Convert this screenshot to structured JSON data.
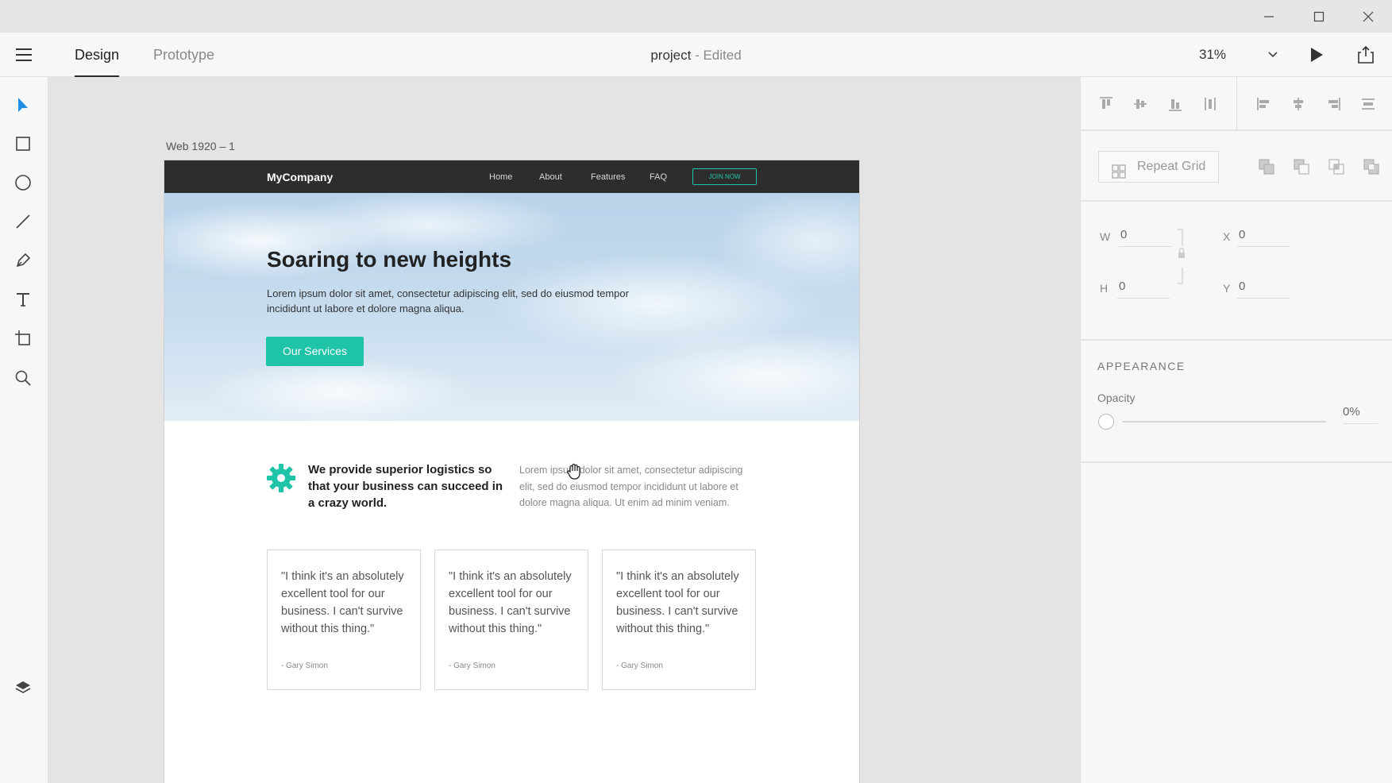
{
  "window": {
    "controls": [
      "minimize-icon",
      "maximize-icon",
      "close-icon"
    ]
  },
  "toolbar": {
    "menu_icon": "hamburger-icon",
    "tabs": [
      {
        "label": "Design",
        "active": true
      },
      {
        "label": "Prototype",
        "active": false
      }
    ],
    "document_name": "project",
    "document_status": " - Edited",
    "zoom": "31%",
    "play_icon": "play-icon",
    "share_icon": "share-icon"
  },
  "tools": [
    "select-icon",
    "rectangle-icon",
    "ellipse-icon",
    "line-icon",
    "pen-icon",
    "text-icon",
    "artboard-icon",
    "zoom-icon",
    "layers-icon"
  ],
  "canvas": {
    "artboard_label": "Web 1920 – 1",
    "site": {
      "brand": "MyCompany",
      "nav": [
        "Home",
        "About",
        "Features",
        "FAQ"
      ],
      "join": "JOIN NOW",
      "accent": "#1fc4a8",
      "hero": {
        "title": "Soaring to new heights",
        "text": "Lorem ipsum dolor sit amet, consectetur adipiscing elit, sed do eiusmod tempor incididunt ut labore et dolore magna aliqua.",
        "cta": "Our Services"
      },
      "feature": {
        "icon": "gear-icon",
        "title": "We provide superior logistics so that your business can succeed in a crazy world.",
        "text": "Lorem ipsum dolor sit amet, consectetur adipiscing elit, sed do eiusmod tempor incididunt ut labore et dolore magna aliqua. Ut enim ad minim veniam."
      },
      "testimonials": [
        {
          "quote": "\"I think it's an absolutely excellent tool for our business. I can't survive without this thing.\"",
          "author": "- Gary Simon"
        },
        {
          "quote": "\"I think it's an absolutely excellent tool for our business. I can't survive without this thing.\"",
          "author": "- Gary Simon"
        },
        {
          "quote": "\"I think it's an absolutely excellent tool for our business. I can't survive without this thing.\"",
          "author": "- Gary Simon"
        }
      ]
    }
  },
  "panel": {
    "align_icons": [
      "align-top-icon",
      "align-middle-icon",
      "align-bottom-icon",
      "distribute-vertical-icon",
      "align-left-icon",
      "align-center-icon",
      "align-right-icon",
      "distribute-horizontal-icon"
    ],
    "repeat_grid": "Repeat Grid",
    "boolean_icons": [
      "add-icon",
      "subtract-icon",
      "intersect-icon",
      "exclude-icon"
    ],
    "w_label": "W",
    "w_value": "0",
    "h_label": "H",
    "h_value": "0",
    "x_label": "X",
    "x_value": "0",
    "y_label": "Y",
    "y_value": "0",
    "appearance_title": "APPEARANCE",
    "opacity_label": "Opacity",
    "opacity_value": "0%",
    "opacity_level": 0
  }
}
